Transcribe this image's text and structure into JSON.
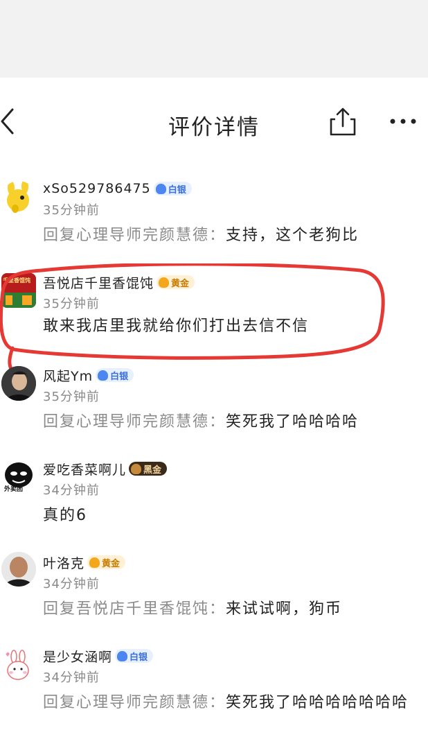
{
  "header": {
    "title": "评价详情",
    "back_icon": "chevron-left-icon",
    "share_icon": "share-icon",
    "more_icon": "more-dots-icon"
  },
  "colors": {
    "highlight_circle": "#e53935",
    "silver_badge": "#4d86f0",
    "gold_badge": "#f3a81c",
    "black_gold_badge": "#3a2a1a",
    "secondary_text": "#8a8a8a"
  },
  "comments": [
    {
      "username": "xSo529786475",
      "badge": "白银",
      "badge_icon": "level-badge-icon",
      "time": "35分钟前",
      "reply_prefix": "回复心理导师完颜慧德：",
      "content": "支持，这个老狗比",
      "avatar": "yellow-cartoon-avatar"
    },
    {
      "username": "吾悦店千里香馄饨",
      "badge": "黄金",
      "badge_icon": "level-badge-icon",
      "time": "35分钟前",
      "reply_prefix": "",
      "content": "敢来我店里我就给你们打出去信不信",
      "avatar": "storefront-avatar",
      "avatar_text": "千里香馄饨",
      "highlighted": true
    },
    {
      "username": "风起Ym",
      "badge": "白银",
      "badge_icon": "level-badge-icon",
      "time": "35分钟前",
      "reply_prefix": "回复心理导师完颜慧德：",
      "content": "笑死我了哈哈哈哈",
      "avatar": "man-portrait-avatar"
    },
    {
      "username": "爱吃香菜啊儿",
      "badge": "黑金",
      "badge_icon": "level-badge-icon",
      "time": "34分钟前",
      "reply_prefix": "",
      "content": "真的6",
      "avatar": "meme-face-avatar",
      "avatar_text": "外卖团"
    },
    {
      "username": "叶洛克",
      "badge": "黄金",
      "badge_icon": "level-badge-icon",
      "time": "34分钟前",
      "reply_prefix": "回复吾悦店千里香馄饨：",
      "content": "来试试啊，狗币",
      "avatar": "bald-man-avatar"
    },
    {
      "username": "是少女涵啊",
      "badge": "白银",
      "badge_icon": "level-badge-icon",
      "time": "34分钟前",
      "reply_prefix": "回复心理导师完颜慧德：",
      "content": "笑死我了哈哈哈哈哈哈哈",
      "avatar": "bunny-sticker-avatar"
    }
  ]
}
